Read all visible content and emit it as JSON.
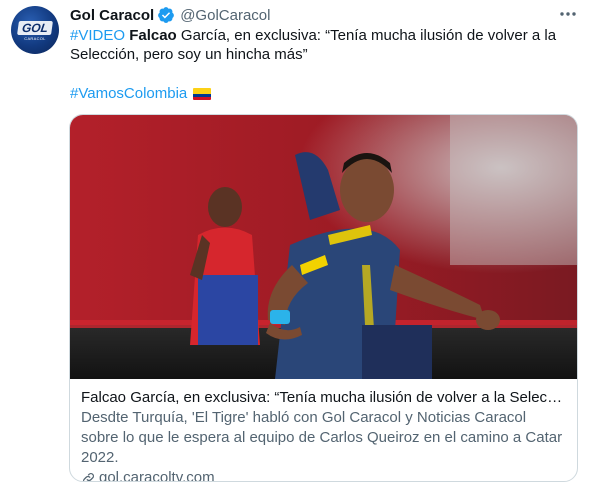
{
  "tweet": {
    "author_name": "Gol Caracol",
    "author_handle": "@GolCaracol",
    "avatar_logo": "GOL",
    "avatar_sub": "CARACOL",
    "text_hashtag": "#VIDEO",
    "text_bold": "Falcao",
    "text_rest": " García, en exclusiva: “Tenía mucha ilusión de volver a la Selección, pero soy un hincha más”",
    "hashtag_line": "#VamosColombia",
    "flag_icon": "colombia-flag",
    "colors": {
      "link": "#1d9bf0",
      "verified": "#1d9bf0",
      "secondary": "#536471",
      "border": "#cfd9de"
    }
  },
  "card": {
    "title": "Falcao García, en exclusiva: “Tenía mucha ilusión de volver a la Selección...",
    "description": "Desdte Turquía, 'El Tigre' habló con Gol Caracol y Noticias Caracol sobre lo que le espera al equipo de Carlos Queiroz en el camino a Catar 2022.",
    "domain": "gol.caracoltv.com"
  }
}
